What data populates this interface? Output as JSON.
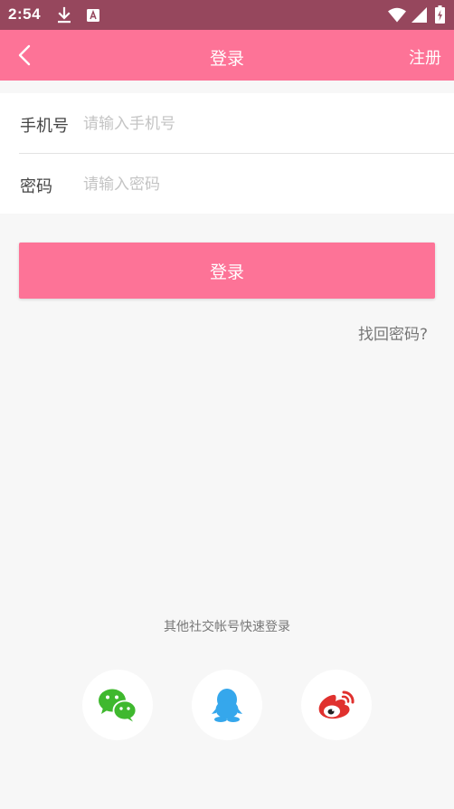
{
  "status_bar": {
    "time": "2:54",
    "icons": [
      "download-icon",
      "text-recognition-icon",
      "wifi-icon",
      "signal-icon",
      "battery-charging-icon"
    ]
  },
  "app_bar": {
    "title": "登录",
    "register_label": "注册",
    "back_icon": "chevron-left-icon"
  },
  "form": {
    "phone_label": "手机号",
    "phone_placeholder": "请输入手机号",
    "phone_value": "",
    "password_label": "密码",
    "password_placeholder": "请输入密码",
    "password_value": ""
  },
  "login_button": "登录",
  "forgot_password": "找回密码?",
  "social": {
    "label": "其他社交帐号快速登录",
    "providers": [
      "wechat-icon",
      "qq-icon",
      "weibo-icon"
    ]
  },
  "colors": {
    "status_bar": "#96475d",
    "primary": "#fd7397",
    "background": "#f7f7f7",
    "wechat": "#3fb82e",
    "qq": "#35a7ec",
    "weibo": "#e0312e"
  }
}
